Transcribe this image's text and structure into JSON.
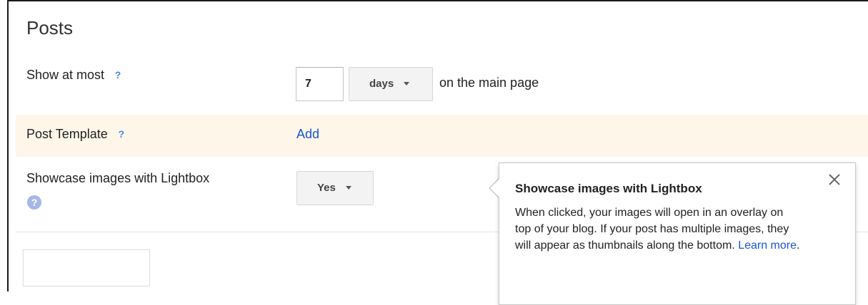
{
  "section": {
    "title": "Posts"
  },
  "show_at_most": {
    "label": "Show at most",
    "help_glyph": "?",
    "value": "7",
    "unit": "days",
    "suffix": "on the main page"
  },
  "post_template": {
    "label": "Post Template",
    "help_glyph": "?",
    "action": "Add",
    "highlight_color": "#fdf6e9"
  },
  "lightbox": {
    "label": "Showcase images with Lightbox",
    "help_glyph": "?",
    "value": "Yes"
  },
  "tooltip": {
    "title": "Showcase images with Lightbox",
    "body": "When clicked, your images will open in an overlay on top of your blog. If your post has multiple images, they will appear as thumbnails along the bottom.",
    "link": "Learn more",
    "end": ".",
    "close_icon": "close-icon"
  },
  "colors": {
    "link": "#1a55d6",
    "help": "#4285f4"
  }
}
